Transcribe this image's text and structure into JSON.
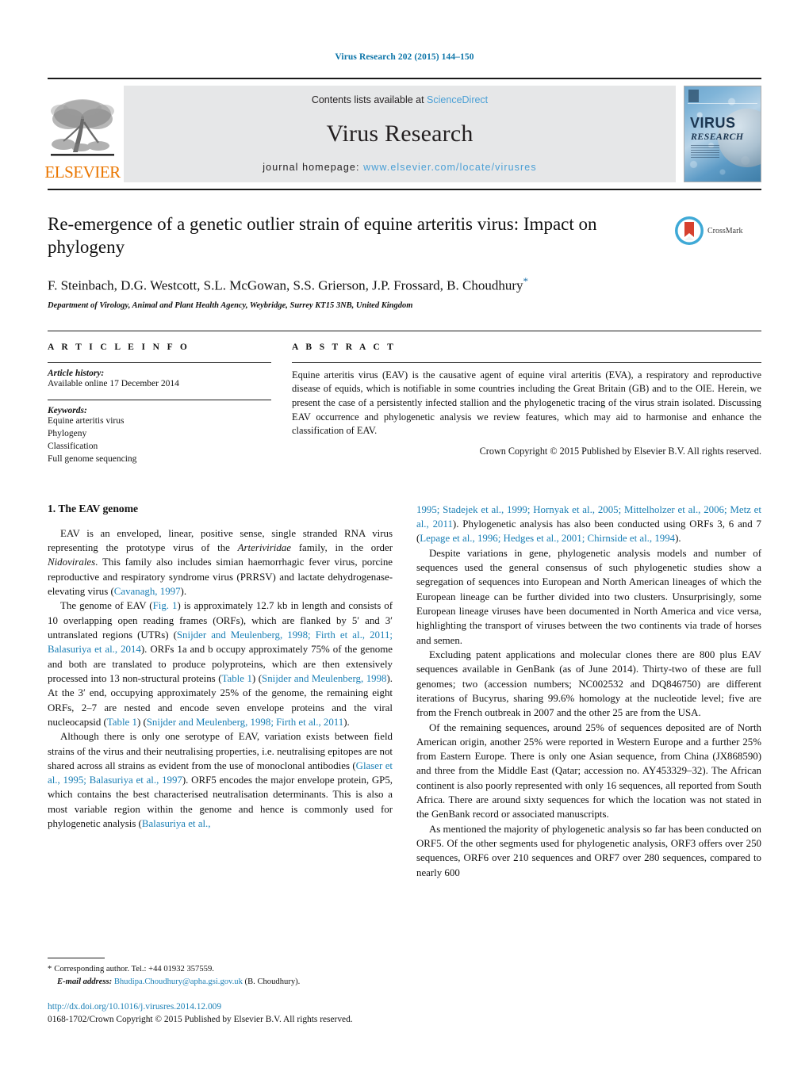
{
  "running_head": "Virus Research 202 (2015) 144–150",
  "masthead": {
    "publisher_name": "ELSEVIER",
    "contents_prefix": "Contents lists available at ",
    "contents_link": "ScienceDirect",
    "journal_title": "Virus Research",
    "homepage_prefix": "journal homepage: ",
    "homepage_url": "www.elsevier.com/locate/virusres",
    "cover_title": "VIRUS",
    "cover_subtitle": "RESEARCH"
  },
  "article": {
    "title": "Re-emergence of a genetic outlier strain of equine arteritis virus: Impact on phylogeny",
    "authors": "F. Steinbach, D.G. Westcott, S.L. McGowan, S.S. Grierson, J.P. Frossard, B. Choudhury",
    "corresponding_marker": "*",
    "affiliation": "Department of Virology, Animal and Plant Health Agency, Weybridge, Surrey KT15 3NB, United Kingdom",
    "crossmark_label": "CrossMark"
  },
  "article_info": {
    "heading": "A R T I C L E   I N F O",
    "history_label": "Article history:",
    "history_value": "Available online 17 December 2014",
    "keywords_label": "Keywords:",
    "keywords": [
      "Equine arteritis virus",
      "Phylogeny",
      "Classification",
      "Full genome sequencing"
    ]
  },
  "abstract": {
    "heading": "A B S T R A C T",
    "text": "Equine arteritis virus (EAV) is the causative agent of equine viral arteritis (EVA), a respiratory and reproductive disease of equids, which is notifiable in some countries including the Great Britain (GB) and to the OIE. Herein, we present the case of a persistently infected stallion and the phylogenetic tracing of the virus strain isolated. Discussing EAV occurrence and phylogenetic analysis we review features, which may aid to harmonise and enhance the classification of EAV.",
    "copyright": "Crown Copyright © 2015  Published by Elsevier B.V. All rights reserved."
  },
  "body": {
    "section1_title": "1.  The EAV genome",
    "left_paragraphs": [
      {
        "id": "p1",
        "parts": [
          {
            "t": "EAV is an enveloped, linear, positive sense, single stranded RNA virus representing the prototype virus of the ",
            "s": "plain"
          },
          {
            "t": "Arteriviridae",
            "s": "ital"
          },
          {
            "t": " family, in the order ",
            "s": "plain"
          },
          {
            "t": "Nidovirales",
            "s": "ital"
          },
          {
            "t": ". This family also includes simian haemorrhagic fever virus, porcine reproductive and respiratory syndrome virus (PRRSV) and lactate dehydrogenase-elevating virus (",
            "s": "plain"
          },
          {
            "t": "Cavanagh, 1997",
            "s": "ref"
          },
          {
            "t": ").",
            "s": "plain"
          }
        ]
      },
      {
        "id": "p2",
        "parts": [
          {
            "t": "The genome of EAV (",
            "s": "plain"
          },
          {
            "t": "Fig. 1",
            "s": "ref"
          },
          {
            "t": ") is approximately 12.7 kb in length and consists of 10 overlapping open reading frames (ORFs), which are flanked by 5′ and 3′ untranslated regions (UTRs) (",
            "s": "plain"
          },
          {
            "t": "Snijder and Meulenberg, 1998; Firth et al., 2011; Balasuriya et al., 2014",
            "s": "ref"
          },
          {
            "t": "). ORFs 1a and b occupy approximately 75% of the genome and both are translated to produce polyproteins, which are then extensively processed into 13 non-structural proteins (",
            "s": "plain"
          },
          {
            "t": "Table 1",
            "s": "ref"
          },
          {
            "t": ") (",
            "s": "plain"
          },
          {
            "t": "Snijder and Meulenberg, 1998",
            "s": "ref"
          },
          {
            "t": "). At the 3′ end, occupying approximately 25% of the genome, the remaining eight ORFs, 2–7 are nested and encode seven envelope proteins and the viral nucleocapsid (",
            "s": "plain"
          },
          {
            "t": "Table 1",
            "s": "ref"
          },
          {
            "t": ") (",
            "s": "plain"
          },
          {
            "t": "Snijder and Meulenberg, 1998; Firth et al., 2011",
            "s": "ref"
          },
          {
            "t": ").",
            "s": "plain"
          }
        ]
      },
      {
        "id": "p3",
        "parts": [
          {
            "t": "Although there is only one serotype of EAV, variation exists between field strains of the virus and their neutralising properties, i.e. neutralising epitopes are not shared across all strains as evident from the use of monoclonal antibodies (",
            "s": "plain"
          },
          {
            "t": "Glaser et al., 1995; Balasuriya et al., 1997",
            "s": "ref"
          },
          {
            "t": "). ORF5 encodes the major envelope protein, GP5, which contains the best characterised neutralisation determinants. This is also a most variable region within the genome and hence is commonly used for phylogenetic analysis (",
            "s": "plain"
          },
          {
            "t": "Balasuriya et al.,",
            "s": "ref"
          }
        ]
      }
    ],
    "right_paragraphs": [
      {
        "id": "p4",
        "parts": [
          {
            "t": "1995; Stadejek et al., 1999; Hornyak et al., 2005; Mittelholzer et al., 2006; Metz et al., 2011",
            "s": "ref"
          },
          {
            "t": "). Phylogenetic analysis has also been conducted using ORFs 3, 6 and 7 (",
            "s": "plain"
          },
          {
            "t": "Lepage et al., 1996; Hedges et al., 2001; Chirnside et al., 1994",
            "s": "ref"
          },
          {
            "t": ").",
            "s": "plain"
          }
        ]
      },
      {
        "id": "p5",
        "parts": [
          {
            "t": "Despite variations in gene, phylogenetic analysis models and number of sequences used the general consensus of such phylogenetic studies show a segregation of sequences into European and North American lineages of which the European lineage can be further divided into two clusters. Unsurprisingly, some European lineage viruses have been documented in North America and vice versa, highlighting the transport of viruses between the two continents via trade of horses and semen.",
            "s": "plain"
          }
        ]
      },
      {
        "id": "p6",
        "parts": [
          {
            "t": "Excluding patent applications and molecular clones there are 800 plus EAV sequences available in GenBank (as of June 2014). Thirty-two of these are full genomes; two (accession numbers; NC002532 and DQ846750) are different iterations of Bucyrus, sharing 99.6% homology at the nucleotide level; five are from the French outbreak in 2007 and the other 25 are from the USA.",
            "s": "plain"
          }
        ]
      },
      {
        "id": "p7",
        "parts": [
          {
            "t": "Of the remaining sequences, around 25% of sequences deposited are of North American origin, another 25% were reported in Western Europe and a further 25% from Eastern Europe. There is only one Asian sequence, from China (JX868590) and three from the Middle East (Qatar; accession no. AY453329–32). The African continent is also poorly represented with only 16 sequences, all reported from South Africa. There are around sixty sequences for which the location was not stated in the GenBank record or associated manuscripts.",
            "s": "plain"
          }
        ]
      },
      {
        "id": "p8",
        "parts": [
          {
            "t": "As mentioned the majority of phylogenetic analysis so far has been conducted on ORF5. Of the other segments used for phylogenetic analysis, ORF3 offers over 250 sequences, ORF6 over 210 sequences and ORF7 over 280 sequences, compared to nearly 600",
            "s": "plain"
          }
        ]
      }
    ]
  },
  "footnotes": {
    "corresponding_star": "*",
    "corresponding_text": "Corresponding author. Tel.: +44 01932 357559.",
    "email_label": "E-mail address:",
    "email_address": "Bhudipa.Choudhury@apha.gsi.gov.uk",
    "email_suffix": "(B. Choudhury).",
    "doi": "http://dx.doi.org/10.1016/j.virusres.2014.12.009",
    "issn_line": "0168-1702/Crown Copyright © 2015  Published by Elsevier B.V. All rights reserved."
  },
  "colors": {
    "link_blue": "#1a7fb5",
    "sciencedirect_blue": "#4a9fd5",
    "elsevier_orange": "#ea7600",
    "masthead_grey": "#e6e7e8"
  }
}
